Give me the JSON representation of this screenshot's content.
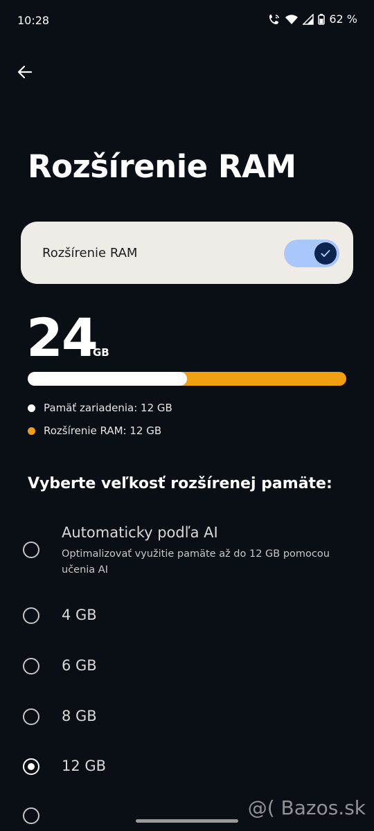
{
  "status_bar": {
    "time": "10:28",
    "battery": "62 %"
  },
  "page": {
    "title": "Rozšírenie RAM"
  },
  "toggle": {
    "label": "Rozšírenie RAM",
    "enabled": true,
    "accent": "#a9c7fa"
  },
  "summary": {
    "total": "24",
    "unit": "GB",
    "device_fraction": 0.5,
    "legend": [
      {
        "label": "Pamäť zariadenia: 12 GB",
        "color": "#ffffff"
      },
      {
        "label": "Rozšírenie RAM: 12 GB",
        "color": "#f0a010"
      }
    ]
  },
  "options_heading": "Vyberte veľkosť rozšírenej pamäte:",
  "options": [
    {
      "title": "Automaticky podľa AI",
      "subtitle": "Optimalizovať využitie pamäte až do 12 GB pomocou učenia AI",
      "selected": false
    },
    {
      "title": "4 GB",
      "selected": false
    },
    {
      "title": "6 GB",
      "selected": false
    },
    {
      "title": "8 GB",
      "selected": false
    },
    {
      "title": "12 GB",
      "selected": true
    }
  ],
  "watermark": "@( Bazos.sk"
}
